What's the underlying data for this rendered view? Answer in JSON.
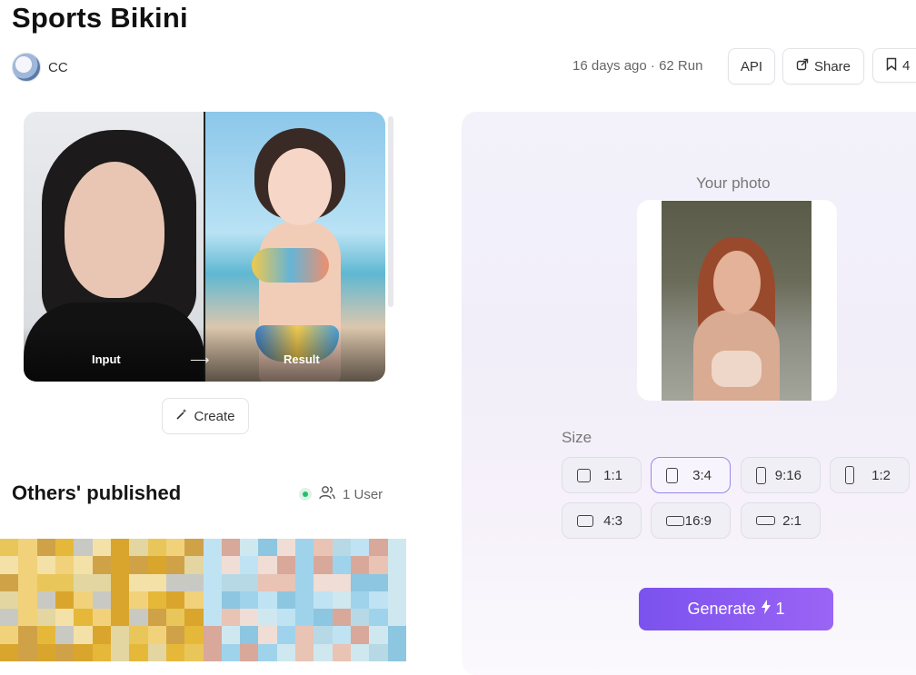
{
  "page": {
    "title": "Sports Bikini"
  },
  "author": {
    "name": "CC"
  },
  "meta": {
    "age": "16 days ago",
    "separator": "·",
    "runs": "62 Run"
  },
  "actions": {
    "api": "API",
    "share": "Share",
    "save_count": "4"
  },
  "showcase": {
    "input_label": "Input",
    "arrow": "⟶",
    "result_label": "Result"
  },
  "create_label": "Create",
  "others": {
    "title": "Others' published",
    "users": "1 User"
  },
  "panel": {
    "photo_label": "Your photo",
    "size_label": "Size",
    "sizes": [
      {
        "label": "1:1",
        "selected": false
      },
      {
        "label": "3:4",
        "selected": true
      },
      {
        "label": "9:16",
        "selected": false
      },
      {
        "label": "1:2",
        "selected": false
      },
      {
        "label": "4:3",
        "selected": false
      },
      {
        "label": "16:9",
        "selected": false
      },
      {
        "label": "2:1",
        "selected": false
      }
    ],
    "generate_label": "Generate",
    "generate_cost": "1",
    "accent_color": "#8456f0"
  }
}
